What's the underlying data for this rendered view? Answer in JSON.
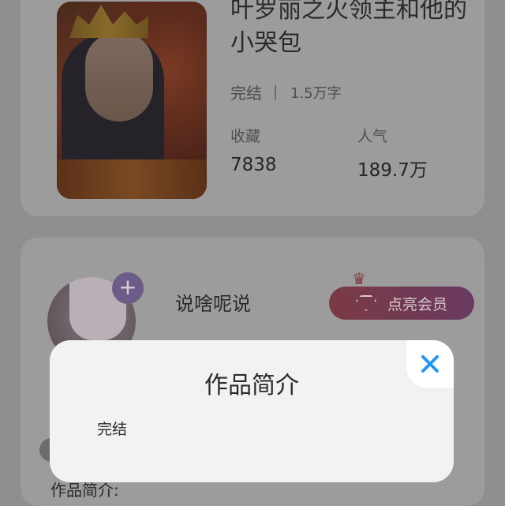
{
  "book": {
    "title": "叶罗丽之火领主和他的小哭包",
    "status": "完结",
    "word_count": "1.5万字",
    "favorites_label": "收藏",
    "favorites_value": "7838",
    "popularity_label": "人气",
    "popularity_value": "189.7万"
  },
  "author": {
    "name": "说啥呢说",
    "follow_symbol": "+",
    "vip_button_label": "点亮会员",
    "vip_icon": "crown-icon"
  },
  "modal": {
    "title": "作品简介",
    "body": "完结",
    "close_icon": "close-icon"
  },
  "underlay": {
    "partial_text": "作品简介:"
  },
  "colors": {
    "close_icon": "#2196f3",
    "background_dim": "#8f8f8f"
  }
}
